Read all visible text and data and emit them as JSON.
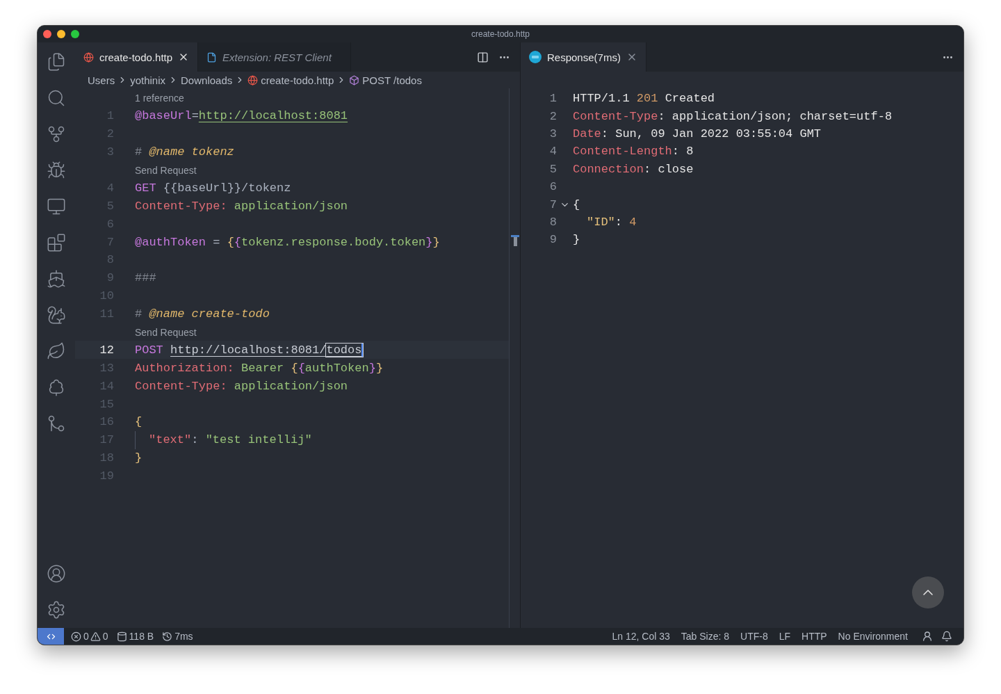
{
  "window": {
    "title": "create-todo.http"
  },
  "left_editor": {
    "tabs": [
      {
        "label": "create-todo.http",
        "kind": "http",
        "selected": true,
        "preview": false
      },
      {
        "label": "Extension: REST Client",
        "kind": "doc",
        "selected": false,
        "preview": true
      }
    ],
    "breadcrumbs": [
      {
        "kind": "folder",
        "text": "Users"
      },
      {
        "kind": "folder",
        "text": "yothinix"
      },
      {
        "kind": "folder",
        "text": "Downloads"
      },
      {
        "kind": "file",
        "text": "create-todo.http"
      },
      {
        "kind": "symbol",
        "text": "POST /todos"
      }
    ],
    "lines": [
      {
        "kind": "codelens",
        "text": "1 reference"
      },
      {
        "kind": "code",
        "number": "1",
        "current": false,
        "guide": false,
        "tokens": [
          {
            "kind": "var",
            "text": "@baseUrl"
          },
          {
            "kind": "plain",
            "text": "="
          },
          {
            "kind": "link-green",
            "text": "http://localhost:8081"
          }
        ]
      },
      {
        "kind": "code",
        "number": "2",
        "current": false,
        "guide": false
      },
      {
        "kind": "code",
        "number": "3",
        "current": false,
        "guide": false,
        "tokens": [
          {
            "kind": "comment",
            "text": "# "
          },
          {
            "kind": "name",
            "text": "@name tokenz"
          }
        ]
      },
      {
        "kind": "codelens",
        "text": "Send Request"
      },
      {
        "kind": "code",
        "number": "4",
        "current": false,
        "guide": false,
        "tokens": [
          {
            "kind": "method",
            "text": "GET "
          },
          {
            "kind": "plain",
            "text": "{{baseUrl}}/tokenz"
          }
        ]
      },
      {
        "kind": "code",
        "number": "5",
        "current": false,
        "guide": false,
        "tokens": [
          {
            "kind": "header",
            "text": "Content-Type: "
          },
          {
            "kind": "value",
            "text": "application/json"
          }
        ]
      },
      {
        "kind": "code",
        "number": "6",
        "current": false,
        "guide": false
      },
      {
        "kind": "code",
        "number": "7",
        "current": false,
        "guide": false,
        "tokens": [
          {
            "kind": "var",
            "text": "@authToken"
          },
          {
            "kind": "plain",
            "text": " = "
          },
          {
            "kind": "brace1",
            "text": "{"
          },
          {
            "kind": "brace2",
            "text": "{"
          },
          {
            "kind": "value",
            "text": "tokenz.response.body.token"
          },
          {
            "kind": "brace2",
            "text": "}"
          },
          {
            "kind": "brace1",
            "text": "}"
          }
        ]
      },
      {
        "kind": "code",
        "number": "8",
        "current": false,
        "guide": false
      },
      {
        "kind": "code",
        "number": "9",
        "current": false,
        "guide": false,
        "tokens": [
          {
            "kind": "comment",
            "text": "###"
          }
        ]
      },
      {
        "kind": "code",
        "number": "10",
        "current": false,
        "guide": false
      },
      {
        "kind": "code",
        "number": "11",
        "current": false,
        "guide": false,
        "tokens": [
          {
            "kind": "comment",
            "text": "# "
          },
          {
            "kind": "name",
            "text": "@name create-todo"
          }
        ]
      },
      {
        "kind": "codelens",
        "text": "Send Request"
      },
      {
        "kind": "code",
        "number": "12",
        "current": true,
        "guide": false,
        "tokens": [
          {
            "kind": "method",
            "text": "POST "
          },
          {
            "kind": "link",
            "text": "http://localhost:8081/"
          },
          {
            "kind": "link-boxed",
            "text": "todos"
          }
        ]
      },
      {
        "kind": "code",
        "number": "13",
        "current": false,
        "guide": false,
        "tokens": [
          {
            "kind": "header",
            "text": "Authorization: "
          },
          {
            "kind": "value",
            "text": "Bearer "
          },
          {
            "kind": "brace1",
            "text": "{"
          },
          {
            "kind": "brace2",
            "text": "{"
          },
          {
            "kind": "value",
            "text": "authToken"
          },
          {
            "kind": "brace2",
            "text": "}"
          },
          {
            "kind": "brace1",
            "text": "}"
          }
        ]
      },
      {
        "kind": "code",
        "number": "14",
        "current": false,
        "guide": false,
        "tokens": [
          {
            "kind": "header",
            "text": "Content-Type: "
          },
          {
            "kind": "value",
            "text": "application/json"
          }
        ]
      },
      {
        "kind": "code",
        "number": "15",
        "current": false,
        "guide": false
      },
      {
        "kind": "code",
        "number": "16",
        "current": false,
        "guide": false,
        "tokens": [
          {
            "kind": "brace1",
            "text": "{"
          }
        ]
      },
      {
        "kind": "code",
        "number": "17",
        "current": false,
        "guide": true,
        "tokens": [
          {
            "kind": "header",
            "text": "\"text\""
          },
          {
            "kind": "plain",
            "text": ": "
          },
          {
            "kind": "value",
            "text": "\"test intellij\""
          }
        ]
      },
      {
        "kind": "code",
        "number": "18",
        "current": false,
        "guide": false,
        "tokens": [
          {
            "kind": "brace1",
            "text": "}"
          }
        ]
      },
      {
        "kind": "code",
        "number": "19",
        "current": false,
        "guide": false
      }
    ]
  },
  "right_editor": {
    "tabs": [
      {
        "label": "Response(7ms)",
        "kind": "rest",
        "selected": true,
        "preview": false
      }
    ],
    "lines": [
      {
        "number": "1",
        "foldable": false,
        "tokens": [
          {
            "kind": "plain",
            "text": "HTTP/1.1 "
          },
          {
            "kind": "number",
            "text": "201"
          },
          {
            "kind": "plain",
            "text": " Created"
          }
        ]
      },
      {
        "number": "2",
        "foldable": false,
        "tokens": [
          {
            "kind": "header",
            "text": "Content-Type"
          },
          {
            "kind": "plain",
            "text": ": application/json; charset=utf-8"
          }
        ]
      },
      {
        "number": "3",
        "foldable": false,
        "tokens": [
          {
            "kind": "header",
            "text": "Date"
          },
          {
            "kind": "plain",
            "text": ": Sun, 09 Jan 2022 03:55:04 GMT"
          }
        ]
      },
      {
        "number": "4",
        "foldable": false,
        "tokens": [
          {
            "kind": "header",
            "text": "Content-Length"
          },
          {
            "kind": "plain",
            "text": ": 8"
          }
        ]
      },
      {
        "number": "5",
        "foldable": false,
        "tokens": [
          {
            "kind": "header",
            "text": "Connection"
          },
          {
            "kind": "plain",
            "text": ": close"
          }
        ]
      },
      {
        "number": "6",
        "foldable": false
      },
      {
        "number": "7",
        "foldable": true,
        "tokens": [
          {
            "kind": "plain",
            "text": "{"
          }
        ],
        "children": [
          {
            "number": "8",
            "foldable": false,
            "tokens": [
              {
                "kind": "jsonkey",
                "text": "\"ID\""
              },
              {
                "kind": "plain",
                "text": ": "
              },
              {
                "kind": "number",
                "text": "4"
              }
            ]
          }
        ]
      },
      {
        "number": "9",
        "foldable": false,
        "tokens": [
          {
            "kind": "plain",
            "text": "}"
          }
        ]
      }
    ]
  },
  "status_bar": {
    "left": [
      {
        "kind": "errors",
        "text": "0"
      },
      {
        "kind": "warnings",
        "text": "0"
      },
      {
        "kind": "size",
        "text": "118 B"
      },
      {
        "kind": "time",
        "text": "7ms"
      }
    ],
    "right": [
      "Ln 12, Col 33",
      "Tab Size: 8",
      "UTF-8",
      "LF",
      "HTTP",
      "No Environment"
    ]
  }
}
